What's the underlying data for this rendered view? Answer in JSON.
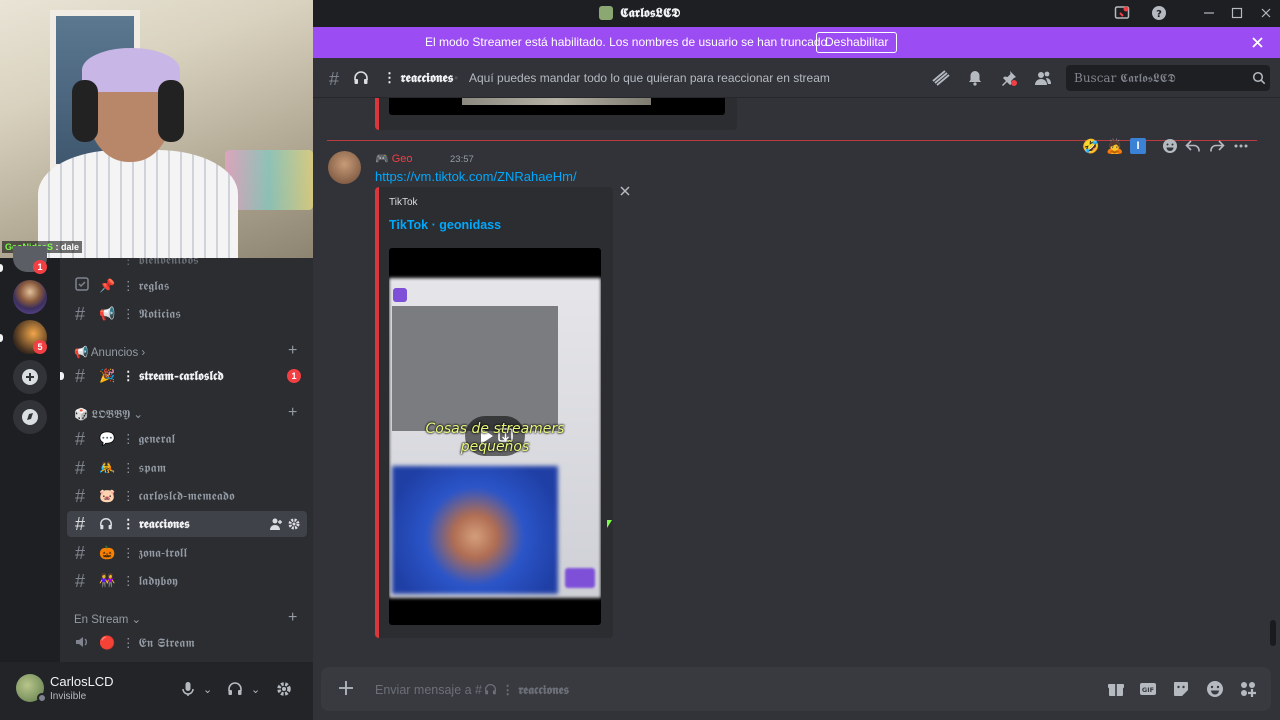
{
  "window": {
    "title": "𝕮𝖆𝖗𝖑𝖔𝖘𝕷𝕮𝕯"
  },
  "webcam": {
    "chat_user": "GeoNidasS",
    "chat_text": ": dale"
  },
  "banner": {
    "text": "El modo Streamer está habilitado. Los nombres de usuario se han truncado.",
    "button": "Deshabilitar"
  },
  "header": {
    "channel": "⋮ 𝖗𝖊𝖆𝖈𝖈𝖎𝖔𝖓𝖊𝖘",
    "topic": "Aquí puedes mandar todo lo que quieran para reaccionar en stream",
    "search_placeholder": "Buscar 𝕮𝖆𝖗𝖑𝖔𝖘𝕷𝕮𝕯"
  },
  "servers": [
    {
      "badge": "1"
    },
    {
      "badge": ""
    },
    {
      "badge": "5"
    }
  ],
  "sidebar": {
    "channels_top": [
      {
        "icon": "📌",
        "name": "⋮ 𝖗𝖊𝖌𝖑𝖆𝖘"
      },
      {
        "icon": "📢",
        "name": "⋮ 𝕹𝖔𝖙𝖎𝖈𝖎𝖆𝖘"
      }
    ],
    "category_announcements": "Anuncios",
    "stream_channel": {
      "icon": "🎉",
      "name": "⋮ 𝖘𝖙𝖗𝖊𝖆𝖒-𝖈𝖆𝖗𝖑𝖔𝖘𝖑𝖈𝖉",
      "badge": "1"
    },
    "category_lobby": "𝕷𝕺𝕭𝕭𝖄",
    "lobby_channels": [
      {
        "icon": "💬",
        "name": "⋮ 𝖌𝖊𝖓𝖊𝖗𝖆𝖑"
      },
      {
        "icon": "🤼",
        "name": "⋮ 𝖘𝖕𝖆𝖒"
      },
      {
        "icon": "🐷",
        "name": "⋮ 𝖈𝖆𝖗𝖑𝖔𝖘𝖑𝖈𝖉-𝖒𝖊𝖒𝖊𝖆𝖉𝖔"
      },
      {
        "icon": "🎧",
        "name": "⋮ 𝖗𝖊𝖆𝖈𝖈𝖎𝖔𝖓𝖊𝖘"
      },
      {
        "icon": "🎃",
        "name": "⋮ 𝖟𝖔𝖓𝖆-𝖙𝖗𝖔𝖑𝖑"
      },
      {
        "icon": "👭",
        "name": "⋮ 𝖑𝖆𝖉𝖞𝖇𝖔𝖞"
      }
    ],
    "category_stream": "En Stream",
    "voice_channel": {
      "icon": "🔴",
      "name": "⋮ 𝕰𝖓 𝕾𝖙𝖗𝖊𝖆𝖒"
    }
  },
  "user": {
    "name": "CarlosLCD",
    "status": "Invisible"
  },
  "message": {
    "author": "🎮 Geo",
    "time": "23:57",
    "link": "https://vm.tiktok.com/ZNRahaeHm/",
    "embed": {
      "provider": "TikTok",
      "title": "TikTok · geonidass",
      "caption": "Cosas de streamers pequeños"
    }
  },
  "composer": {
    "placeholder": "Enviar mensaje a #",
    "channel": " ⋮ 𝖗𝖊𝖆𝖈𝖈𝖎𝖔𝖓𝖊𝖘"
  },
  "colors": {
    "accent": "#9b4cf2",
    "link": "#00a8fc",
    "danger": "#f23f43",
    "bg": "#313338",
    "sidebar": "#2b2d31"
  }
}
